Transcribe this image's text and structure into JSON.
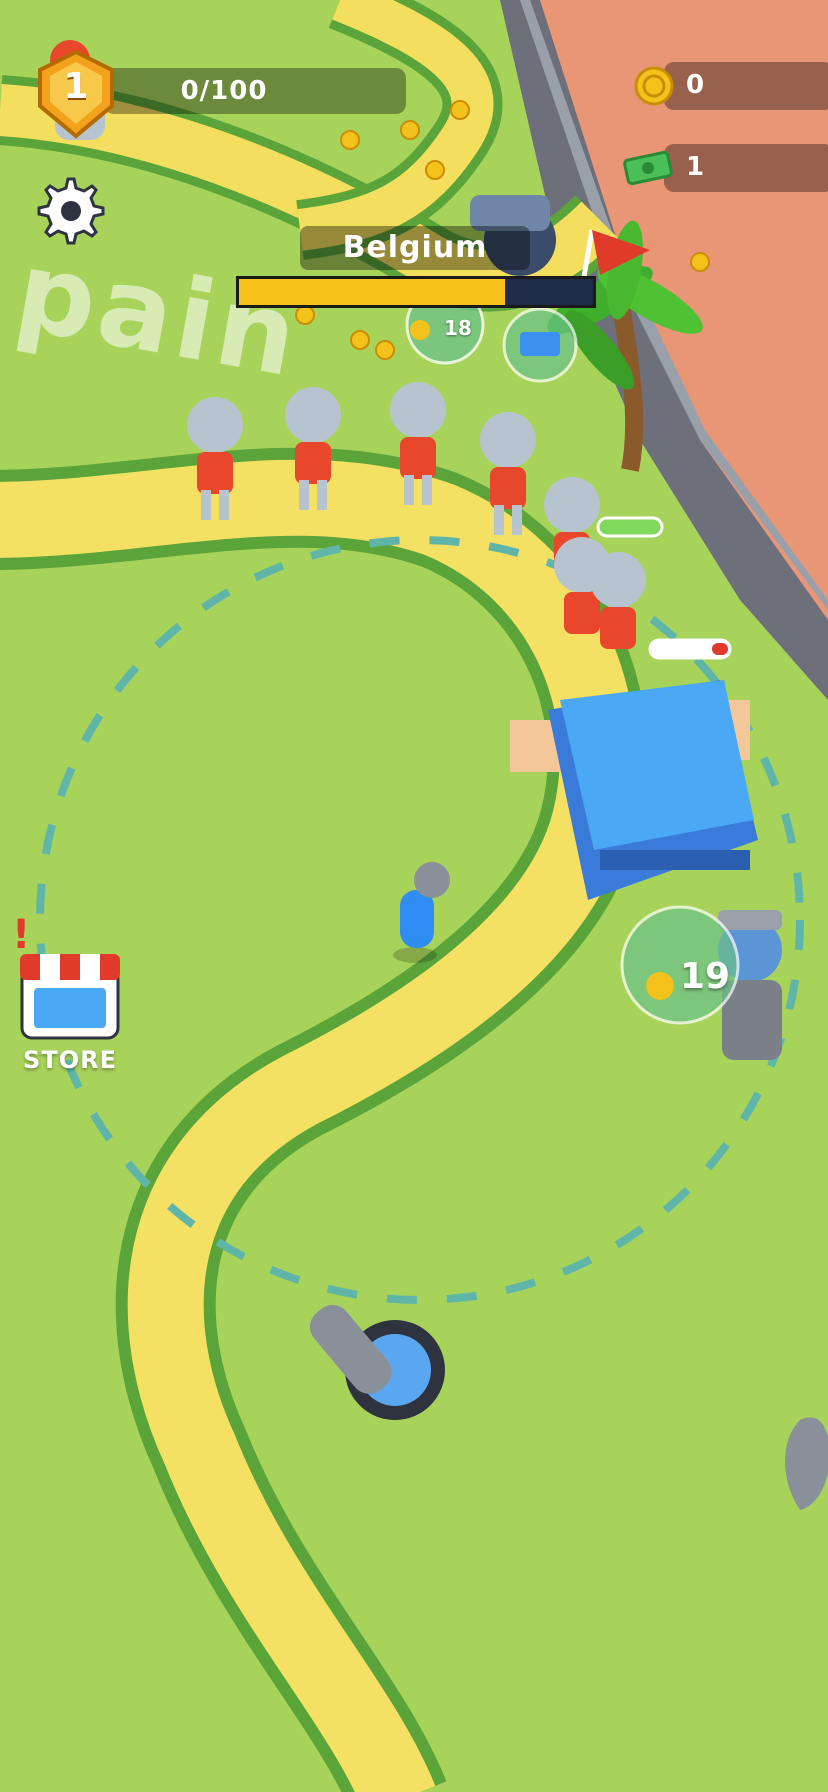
{
  "hud": {
    "level": "1",
    "xp_text": "0/100",
    "coins": "0",
    "cash": "1"
  },
  "target": {
    "country": "Belgium",
    "capture_progress": 0.75,
    "coin_cost": "18"
  },
  "upgrade": {
    "coin_cost": "19"
  },
  "store": {
    "label": "STORE"
  },
  "map_text": "pain",
  "colors": {
    "grass": "#a9d25a",
    "path": "#f4e063",
    "capture_fill": "#f6c21b",
    "enemy_team": "#e8472c",
    "player_team": "#2f8cf2",
    "base_roof": "#4aa8f5"
  }
}
